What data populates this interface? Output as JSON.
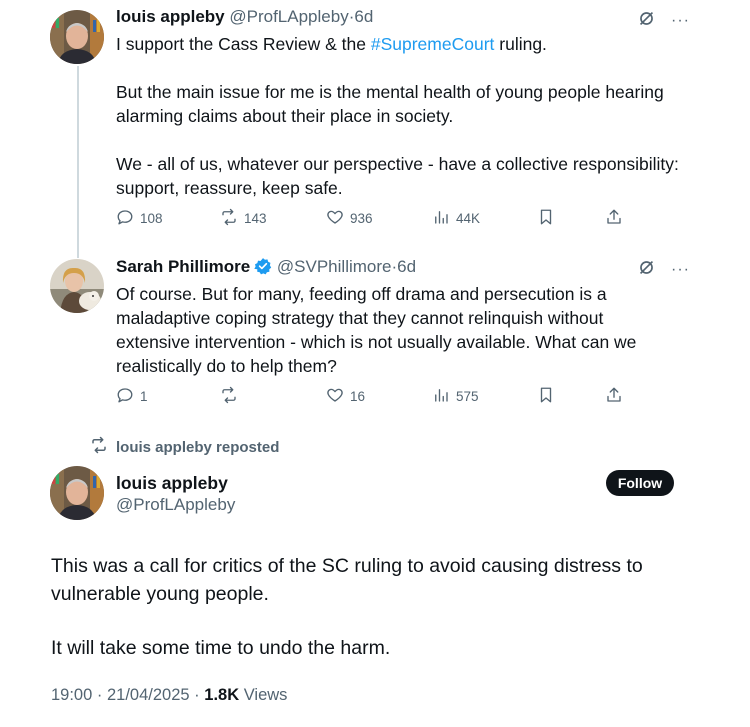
{
  "tweet1": {
    "name": "louis appleby",
    "handle": "@ProfLAppleby",
    "sep": "·",
    "time": "6d",
    "text_pre": "I support the Cass Review & the ",
    "hashtag": "#SupremeCourt",
    "text_post": " ruling.",
    "para2": "But the main issue for me is the mental health of young people hearing alarming claims about their place in society.",
    "para3": "We - all of us, whatever our perspective - have a collective responsibility: support, reassure, keep safe.",
    "replies": "108",
    "reposts": "143",
    "likes": "936",
    "views": "44K"
  },
  "tweet2": {
    "name": "Sarah Phillimore",
    "verified": true,
    "handle": "@SVPhillimore",
    "sep": "·",
    "time": "6d",
    "text": "Of course. But for many, feeding off drama and persecution is a maladaptive coping strategy that they cannot relinquish without extensive intervention - which is not usually available. What can we realistically do to help them?",
    "replies": "1",
    "reposts": "",
    "likes": "16",
    "views": "575"
  },
  "repost_banner": "louis appleby reposted",
  "main": {
    "name": "louis appleby",
    "handle": "@ProfLAppleby",
    "follow_label": "Follow",
    "para1": "This was a call for critics of the SC ruling to avoid causing distress to vulnerable young people.",
    "para2": "It will take some time to undo the harm.",
    "time": "19:00",
    "date": "21/04/2025",
    "dot": "·",
    "views_count": "1.8K",
    "views_label": "Views"
  },
  "colors": {
    "accent": "#1d9bf0",
    "text": "#0f1419",
    "muted": "#536471",
    "thread_line": "#cfd9de"
  },
  "icons": [
    "reply-icon",
    "repost-icon",
    "like-icon",
    "views-icon",
    "bookmark-icon",
    "share-icon",
    "grok-icon",
    "more-icon",
    "verified-badge-icon"
  ]
}
